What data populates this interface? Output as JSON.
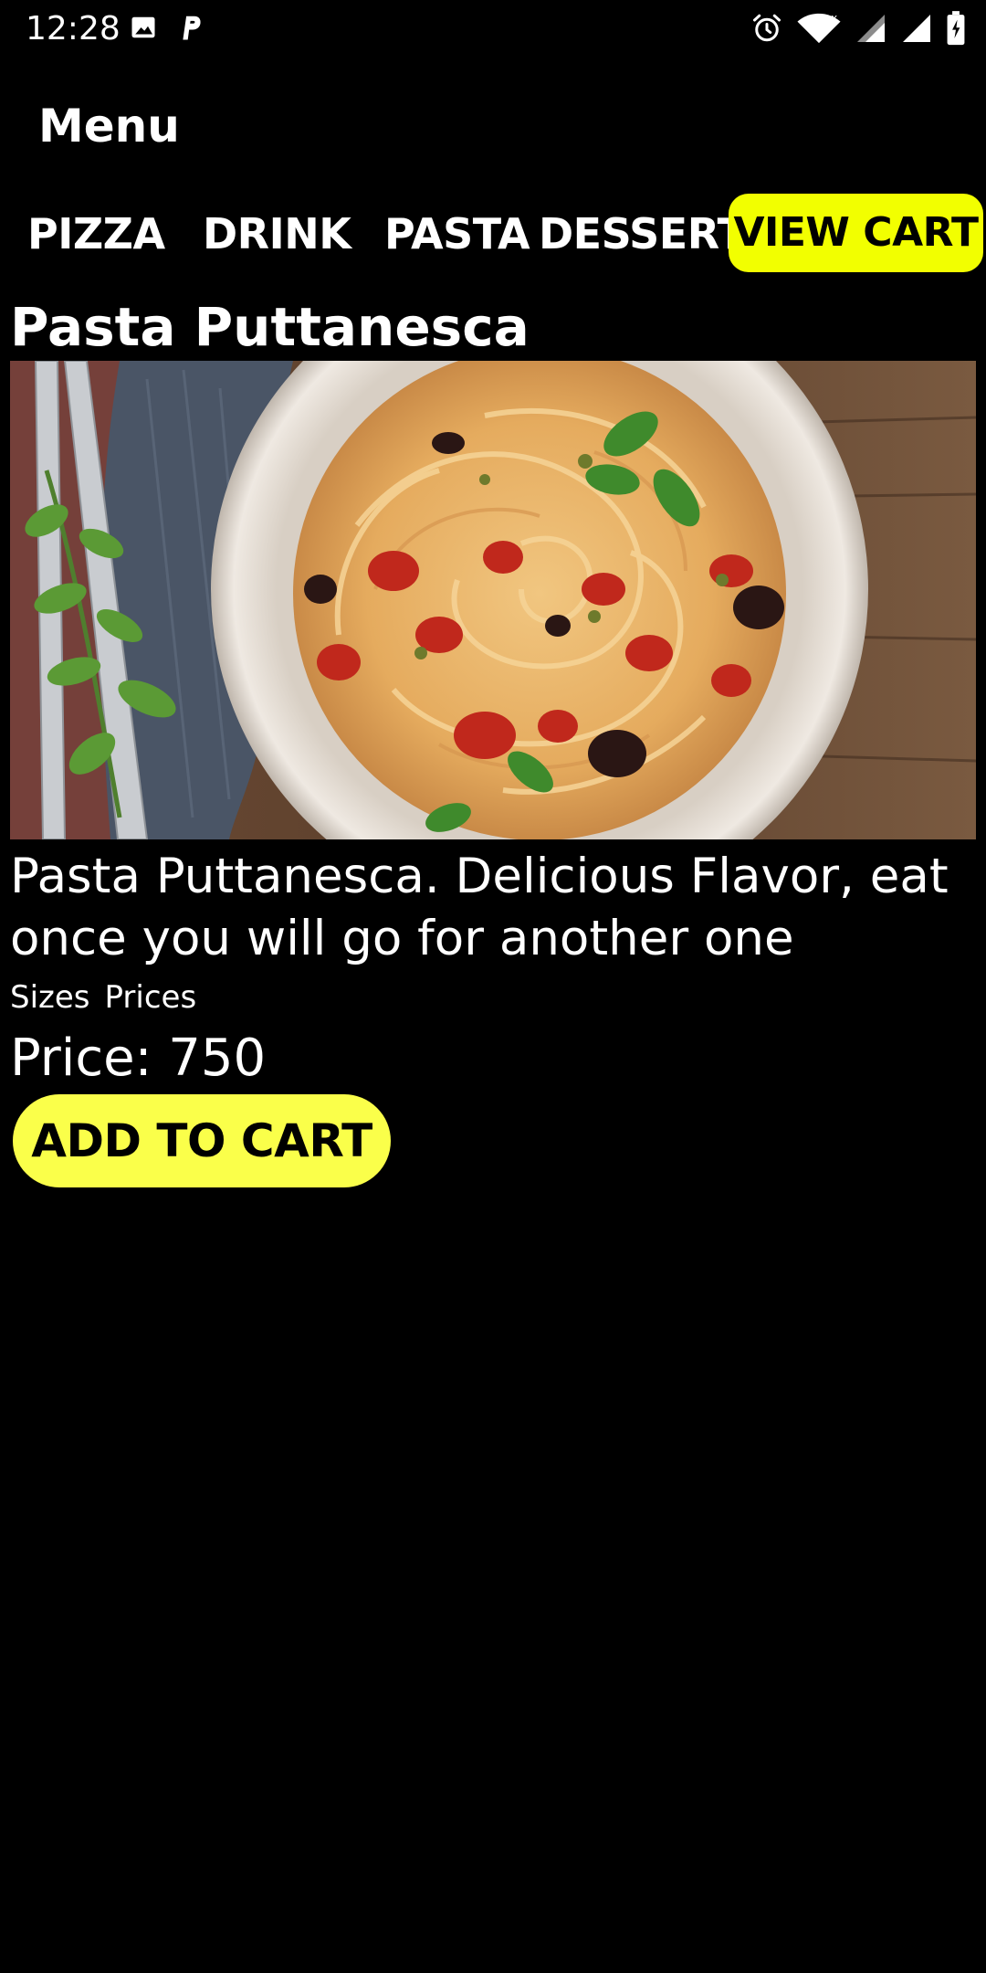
{
  "status_bar": {
    "time": "12:28",
    "left_icons": [
      "image-icon",
      "parking-icon"
    ],
    "right_icons": [
      "alarm-icon",
      "wifi-icon",
      "cellular-signal-icon",
      "cellular-signal-icon",
      "battery-icon"
    ]
  },
  "header": {
    "title": "Menu"
  },
  "tabs": [
    {
      "label": "PIZZA"
    },
    {
      "label": "DRINK"
    },
    {
      "label": "PASTA"
    },
    {
      "label": "DESSERT"
    }
  ],
  "view_cart_label": "VIEW CART",
  "product": {
    "name": "Pasta Puttanesca",
    "image_icon": "pasta-dish-photo",
    "description": "Pasta Puttanesca. Delicious Flavor, eat once you will go for another one",
    "sizes_label": "Sizes",
    "prices_label": "Prices",
    "price_text": "Price: 750"
  },
  "add_to_cart_label": "ADD TO CART",
  "colors": {
    "background": "#000000",
    "accent": "#f2ff00",
    "add_to_cart_bg": "#faff4a",
    "text": "#ffffff"
  }
}
